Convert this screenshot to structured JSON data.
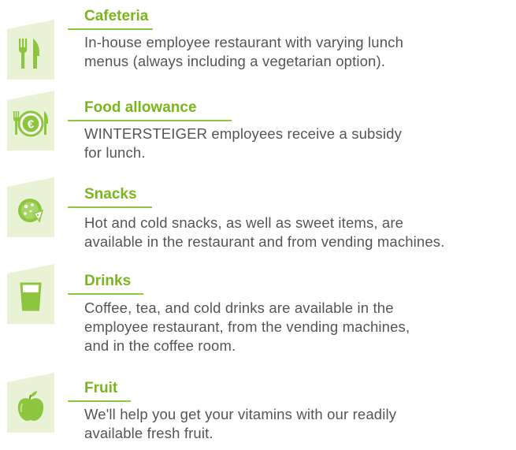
{
  "colors": {
    "accent_green": "#7ab51d",
    "icon_green": "#8cc63e",
    "icon_bg": "#eaf2d6",
    "text_gray": "#555555"
  },
  "benefits": [
    {
      "icon": "cutlery-icon",
      "title": "Cafeteria",
      "lines": [
        "In-house employee restaurant with varying lunch",
        "menus (always including a vegetarian option)."
      ]
    },
    {
      "icon": "euro-plate-icon",
      "title": "Food allowance",
      "lines": [
        "WINTERSTEIGER employees receive a subsidy",
        "for lunch."
      ]
    },
    {
      "icon": "pizza-icon",
      "title": "Snacks",
      "lines": [
        "Hot and cold snacks, as well as sweet items, are",
        "available in the restaurant and from vending machines."
      ]
    },
    {
      "icon": "glass-icon",
      "title": "Drinks",
      "lines": [
        "Coffee, tea, and cold drinks are available in the",
        "employee restaurant, from the vending machines,",
        "and in the coffee room."
      ]
    },
    {
      "icon": "apple-icon",
      "title": "Fruit",
      "lines": [
        "We'll help you get your vitamins with our readily",
        "available fresh fruit."
      ]
    }
  ]
}
